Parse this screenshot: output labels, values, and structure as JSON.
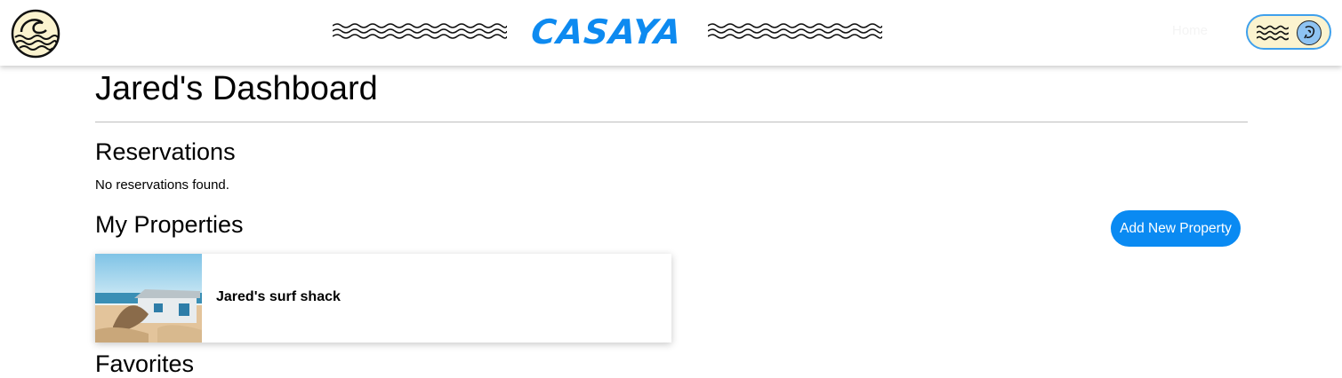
{
  "header": {
    "brand": "CASAYA",
    "logo_icon": "wave-logo-icon",
    "nav_home": "Home",
    "menu_icon": "waves-menu-icon",
    "avatar_icon": "user-avatar-icon",
    "colors": {
      "brand": "#0d8af0",
      "pill_bg": "#fbf3cf",
      "pill_border": "#3fa0ec",
      "avatar_bg": "#8ec3f2"
    }
  },
  "main": {
    "title": "Jared's Dashboard",
    "reservations": {
      "title": "Reservations",
      "empty_message": "No reservations found."
    },
    "properties": {
      "title": "My Properties",
      "add_button_label": "Add New Property",
      "items": [
        {
          "name": "Jared's surf shack"
        }
      ]
    },
    "next_section_title": "Favorites"
  },
  "colors": {
    "accent": "#0a8af2",
    "divider": "#bdbdbd"
  }
}
